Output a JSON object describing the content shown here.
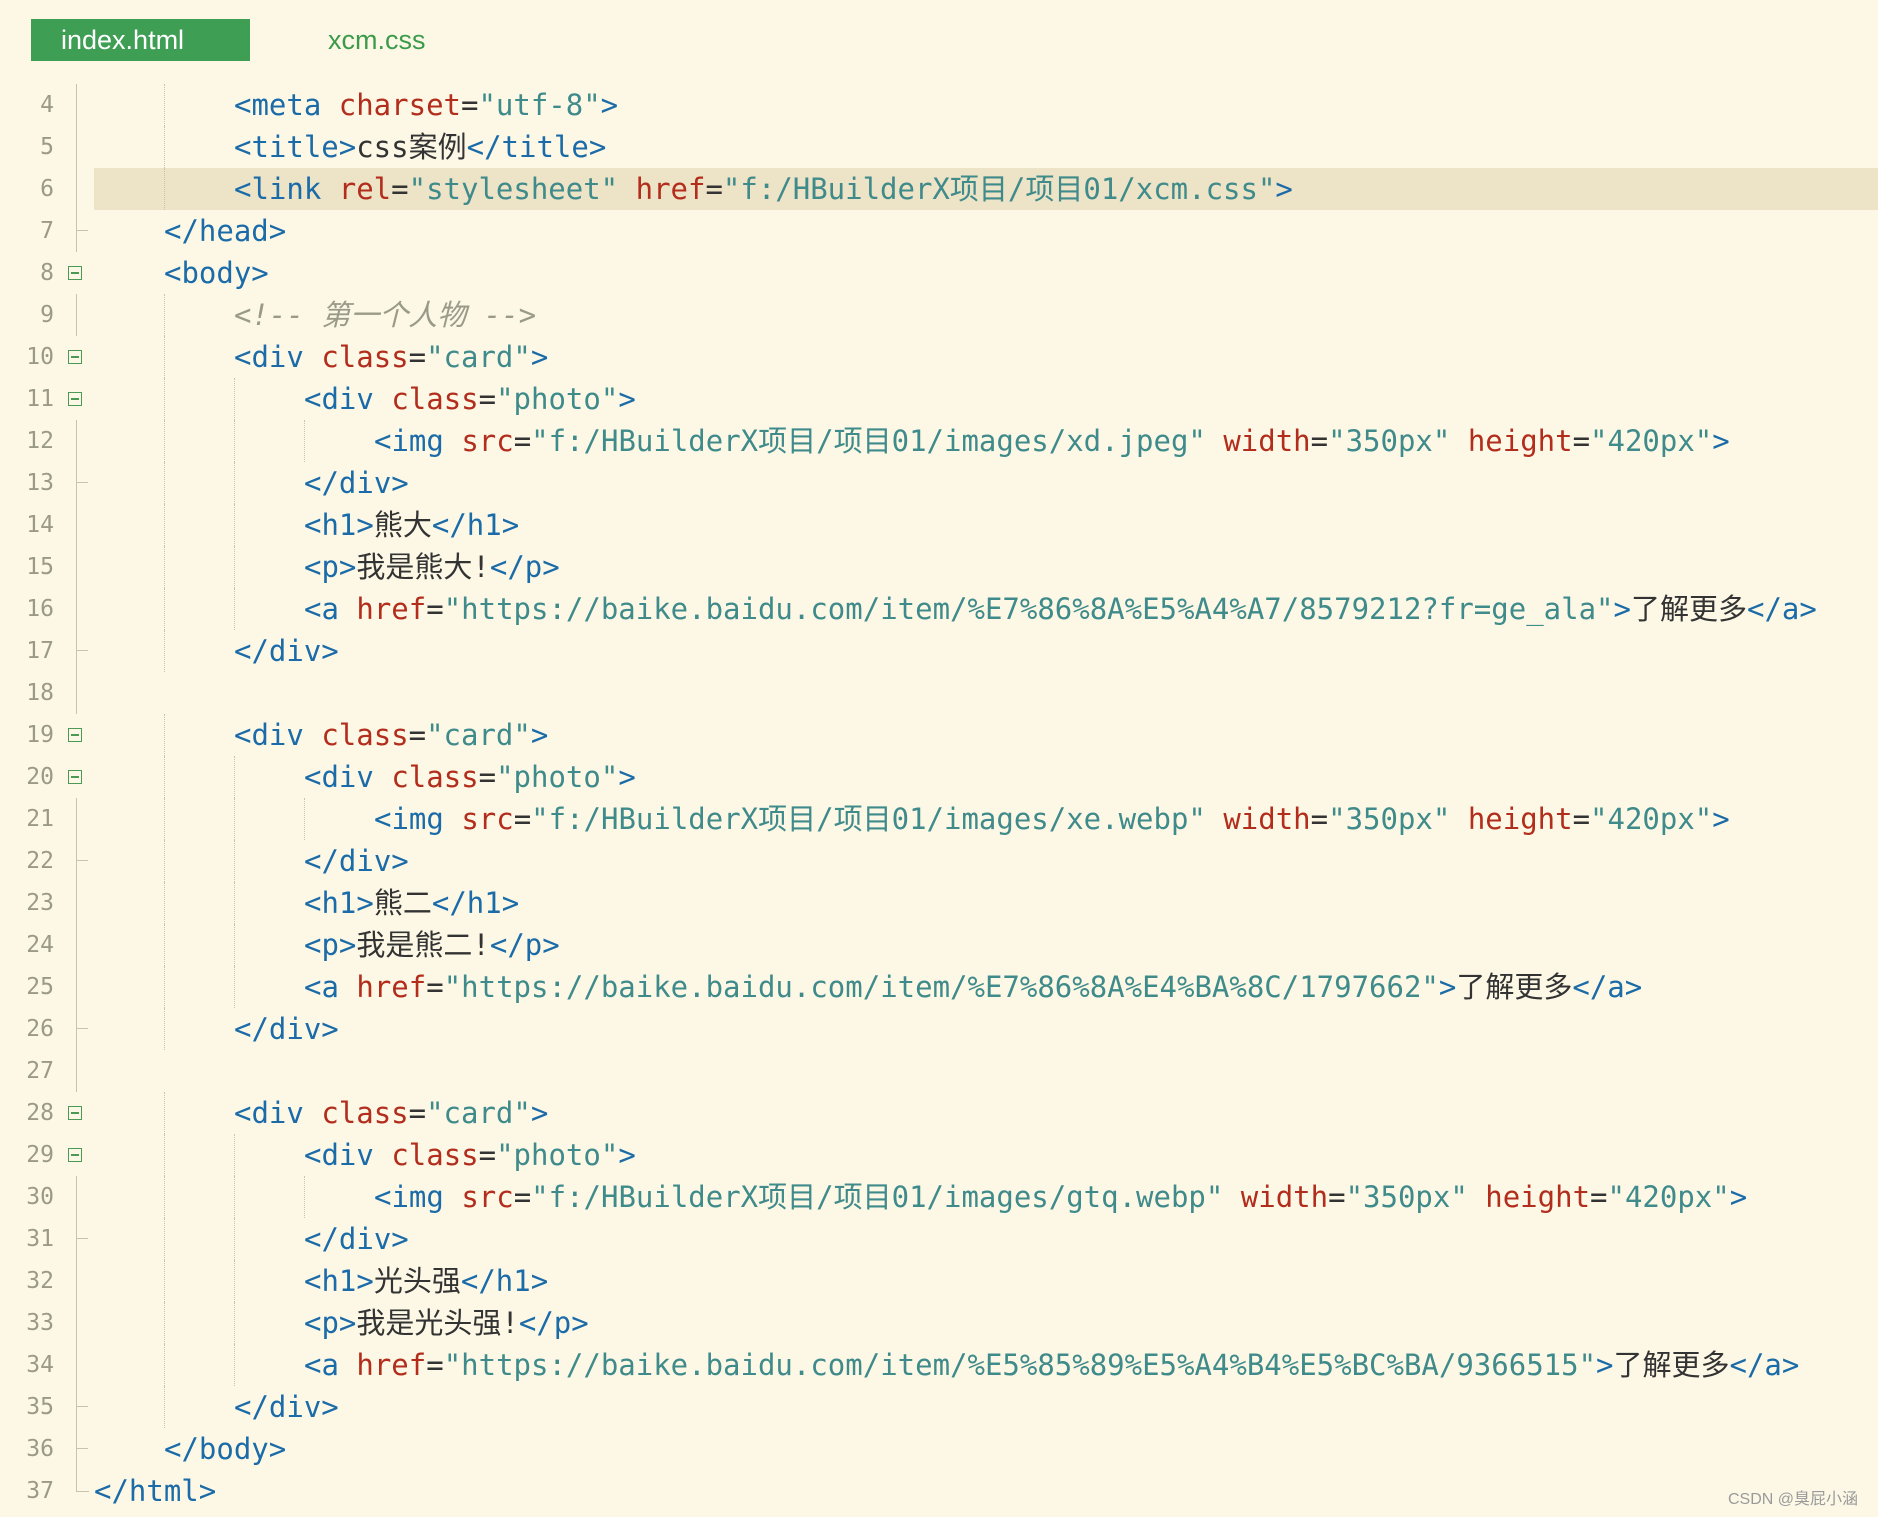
{
  "tabs": [
    {
      "label": "index.html",
      "active": true
    },
    {
      "label": "xcm.css",
      "active": false
    }
  ],
  "colors": {
    "background": "#fdf8e6",
    "active_tab": "#3d9e54",
    "tag": "#1b6ba8",
    "attribute": "#b22d1c",
    "value": "#3f8a8a",
    "comment": "#9a9a88",
    "line_highlight": "#ede3c6"
  },
  "highlighted_line": 6,
  "editor": {
    "lines": [
      {
        "num": "4",
        "indent": 2,
        "fold": "line",
        "tokens": [
          [
            "t",
            "<meta "
          ],
          [
            "a",
            "charset"
          ],
          [
            "p",
            "="
          ],
          [
            "v",
            "\"utf-8\""
          ],
          [
            "t",
            ">"
          ]
        ]
      },
      {
        "num": "5",
        "indent": 2,
        "fold": "line",
        "tokens": [
          [
            "t",
            "<title>"
          ],
          [
            "x",
            "css案例"
          ],
          [
            "t",
            "</title>"
          ]
        ]
      },
      {
        "num": "6",
        "indent": 2,
        "fold": "line",
        "tokens": [
          [
            "t",
            "<link "
          ],
          [
            "a",
            "rel"
          ],
          [
            "p",
            "="
          ],
          [
            "v",
            "\"stylesheet\" "
          ],
          [
            "a",
            "href"
          ],
          [
            "p",
            "="
          ],
          [
            "v",
            "\"f:/HBuilderX项目/项目01/xcm.css\""
          ],
          [
            "t",
            ">"
          ]
        ]
      },
      {
        "num": "7",
        "indent": 1,
        "fold": "end",
        "tokens": [
          [
            "t",
            "</head>"
          ]
        ]
      },
      {
        "num": "8",
        "indent": 1,
        "fold": "box",
        "tokens": [
          [
            "t",
            "<body>"
          ]
        ]
      },
      {
        "num": "9",
        "indent": 2,
        "fold": "line",
        "tokens": [
          [
            "c",
            "<!-- 第一个人物 -->"
          ]
        ]
      },
      {
        "num": "10",
        "indent": 2,
        "fold": "box",
        "tokens": [
          [
            "t",
            "<div "
          ],
          [
            "a",
            "class"
          ],
          [
            "p",
            "="
          ],
          [
            "v",
            "\"card\""
          ],
          [
            "t",
            ">"
          ]
        ]
      },
      {
        "num": "11",
        "indent": 3,
        "fold": "box",
        "tokens": [
          [
            "t",
            "<div "
          ],
          [
            "a",
            "class"
          ],
          [
            "p",
            "="
          ],
          [
            "v",
            "\"photo\""
          ],
          [
            "t",
            ">"
          ]
        ]
      },
      {
        "num": "12",
        "indent": 4,
        "fold": "line",
        "tokens": [
          [
            "t",
            "<img "
          ],
          [
            "a",
            "src"
          ],
          [
            "p",
            "="
          ],
          [
            "v",
            "\"f:/HBuilderX项目/项目01/images/xd.jpeg\" "
          ],
          [
            "a",
            "width"
          ],
          [
            "p",
            "="
          ],
          [
            "v",
            "\"350px\" "
          ],
          [
            "a",
            "height"
          ],
          [
            "p",
            "="
          ],
          [
            "v",
            "\"420px\""
          ],
          [
            "t",
            ">"
          ]
        ]
      },
      {
        "num": "13",
        "indent": 3,
        "fold": "end",
        "tokens": [
          [
            "t",
            "</div>"
          ]
        ]
      },
      {
        "num": "14",
        "indent": 3,
        "fold": "line",
        "tokens": [
          [
            "t",
            "<h1>"
          ],
          [
            "x",
            "熊大"
          ],
          [
            "t",
            "</h1>"
          ]
        ]
      },
      {
        "num": "15",
        "indent": 3,
        "fold": "line",
        "tokens": [
          [
            "t",
            "<p>"
          ],
          [
            "x",
            "我是熊大!"
          ],
          [
            "t",
            "</p>"
          ]
        ]
      },
      {
        "num": "16",
        "indent": 3,
        "fold": "line",
        "tokens": [
          [
            "t",
            "<a "
          ],
          [
            "a",
            "href"
          ],
          [
            "p",
            "="
          ],
          [
            "v",
            "\"https://baike.baidu.com/item/%E7%86%8A%E5%A4%A7/8579212?fr=ge_ala\""
          ],
          [
            "t",
            ">"
          ],
          [
            "x",
            "了解更多"
          ],
          [
            "t",
            "</a>"
          ]
        ]
      },
      {
        "num": "17",
        "indent": 2,
        "fold": "end",
        "tokens": [
          [
            "t",
            "</div>"
          ]
        ]
      },
      {
        "num": "18",
        "indent": 0,
        "fold": "line",
        "tokens": []
      },
      {
        "num": "19",
        "indent": 2,
        "fold": "box",
        "tokens": [
          [
            "t",
            "<div "
          ],
          [
            "a",
            "class"
          ],
          [
            "p",
            "="
          ],
          [
            "v",
            "\"card\""
          ],
          [
            "t",
            ">"
          ]
        ]
      },
      {
        "num": "20",
        "indent": 3,
        "fold": "box",
        "tokens": [
          [
            "t",
            "<div "
          ],
          [
            "a",
            "class"
          ],
          [
            "p",
            "="
          ],
          [
            "v",
            "\"photo\""
          ],
          [
            "t",
            ">"
          ]
        ]
      },
      {
        "num": "21",
        "indent": 4,
        "fold": "line",
        "tokens": [
          [
            "t",
            "<img "
          ],
          [
            "a",
            "src"
          ],
          [
            "p",
            "="
          ],
          [
            "v",
            "\"f:/HBuilderX项目/项目01/images/xe.webp\" "
          ],
          [
            "a",
            "width"
          ],
          [
            "p",
            "="
          ],
          [
            "v",
            "\"350px\" "
          ],
          [
            "a",
            "height"
          ],
          [
            "p",
            "="
          ],
          [
            "v",
            "\"420px\""
          ],
          [
            "t",
            ">"
          ]
        ]
      },
      {
        "num": "22",
        "indent": 3,
        "fold": "end",
        "tokens": [
          [
            "t",
            "</div>"
          ]
        ]
      },
      {
        "num": "23",
        "indent": 3,
        "fold": "line",
        "tokens": [
          [
            "t",
            "<h1>"
          ],
          [
            "x",
            "熊二"
          ],
          [
            "t",
            "</h1>"
          ]
        ]
      },
      {
        "num": "24",
        "indent": 3,
        "fold": "line",
        "tokens": [
          [
            "t",
            "<p>"
          ],
          [
            "x",
            "我是熊二!"
          ],
          [
            "t",
            "</p>"
          ]
        ]
      },
      {
        "num": "25",
        "indent": 3,
        "fold": "line",
        "tokens": [
          [
            "t",
            "<a "
          ],
          [
            "a",
            "href"
          ],
          [
            "p",
            "="
          ],
          [
            "v",
            "\"https://baike.baidu.com/item/%E7%86%8A%E4%BA%8C/1797662\""
          ],
          [
            "t",
            ">"
          ],
          [
            "x",
            "了解更多"
          ],
          [
            "t",
            "</a>"
          ]
        ]
      },
      {
        "num": "26",
        "indent": 2,
        "fold": "end",
        "tokens": [
          [
            "t",
            "</div>"
          ]
        ]
      },
      {
        "num": "27",
        "indent": 0,
        "fold": "line",
        "tokens": []
      },
      {
        "num": "28",
        "indent": 2,
        "fold": "box",
        "tokens": [
          [
            "t",
            "<div "
          ],
          [
            "a",
            "class"
          ],
          [
            "p",
            "="
          ],
          [
            "v",
            "\"card\""
          ],
          [
            "t",
            ">"
          ]
        ]
      },
      {
        "num": "29",
        "indent": 3,
        "fold": "box",
        "tokens": [
          [
            "t",
            "<div "
          ],
          [
            "a",
            "class"
          ],
          [
            "p",
            "="
          ],
          [
            "v",
            "\"photo\""
          ],
          [
            "t",
            ">"
          ]
        ]
      },
      {
        "num": "30",
        "indent": 4,
        "fold": "line",
        "tokens": [
          [
            "t",
            "<img "
          ],
          [
            "a",
            "src"
          ],
          [
            "p",
            "="
          ],
          [
            "v",
            "\"f:/HBuilderX项目/项目01/images/gtq.webp\" "
          ],
          [
            "a",
            "width"
          ],
          [
            "p",
            "="
          ],
          [
            "v",
            "\"350px\" "
          ],
          [
            "a",
            "height"
          ],
          [
            "p",
            "="
          ],
          [
            "v",
            "\"420px\""
          ],
          [
            "t",
            ">"
          ]
        ]
      },
      {
        "num": "31",
        "indent": 3,
        "fold": "end",
        "tokens": [
          [
            "t",
            "</div>"
          ]
        ]
      },
      {
        "num": "32",
        "indent": 3,
        "fold": "line",
        "tokens": [
          [
            "t",
            "<h1>"
          ],
          [
            "x",
            "光头强"
          ],
          [
            "t",
            "</h1>"
          ]
        ]
      },
      {
        "num": "33",
        "indent": 3,
        "fold": "line",
        "tokens": [
          [
            "t",
            "<p>"
          ],
          [
            "x",
            "我是光头强!"
          ],
          [
            "t",
            "</p>"
          ]
        ]
      },
      {
        "num": "34",
        "indent": 3,
        "fold": "line",
        "tokens": [
          [
            "t",
            "<a "
          ],
          [
            "a",
            "href"
          ],
          [
            "p",
            "="
          ],
          [
            "v",
            "\"https://baike.baidu.com/item/%E5%85%89%E5%A4%B4%E5%BC%BA/9366515\""
          ],
          [
            "t",
            ">"
          ],
          [
            "x",
            "了解更多"
          ],
          [
            "t",
            "</a>"
          ]
        ]
      },
      {
        "num": "35",
        "indent": 2,
        "fold": "end",
        "tokens": [
          [
            "t",
            "</div>"
          ]
        ]
      },
      {
        "num": "36",
        "indent": 1,
        "fold": "end",
        "tokens": [
          [
            "t",
            "</body>"
          ]
        ]
      },
      {
        "num": "37",
        "indent": 0,
        "fold": "corner",
        "tokens": [
          [
            "t",
            "</html>"
          ]
        ]
      }
    ]
  },
  "watermark": "CSDN @臭屁小涵"
}
